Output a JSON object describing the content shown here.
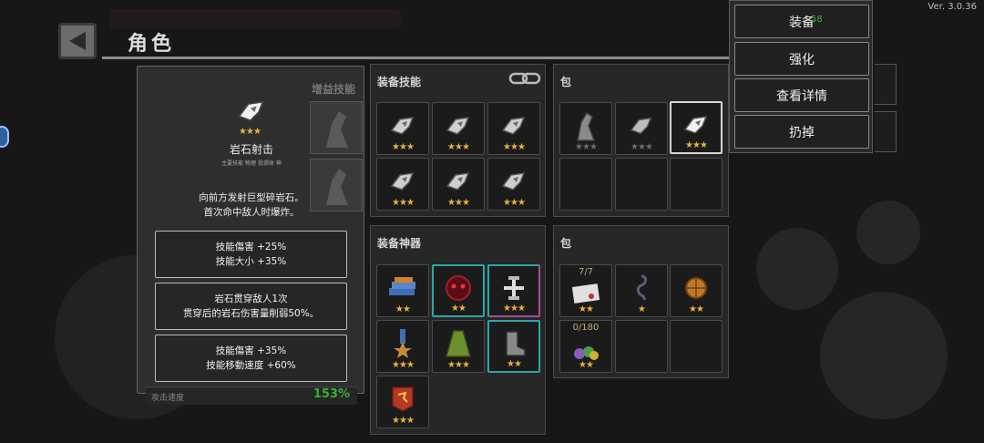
{
  "version": "Ver. 3.0.36",
  "header": {
    "title": "角色"
  },
  "detail": {
    "skill_name": "岩石射击",
    "skill_tags": "主要技能  物理  投掷体  神",
    "stars": "★★★",
    "description": "向前方发射巨型碎岩石。\n首次命中敌人时爆炸。",
    "upgrades": [
      "技能傷害 +25%\n技能大小 +35%",
      "岩石贯穿敌人1次\n贯穿后的岩石伤害量削弱50%。",
      "技能傷害 +35%\n技能移動速度 +60%"
    ],
    "side_label": "增益技能"
  },
  "stat_row": {
    "label": "攻击速度",
    "value": "153%"
  },
  "panels": {
    "equip_skills": {
      "title": "装备技能",
      "slots": [
        {
          "icon": "rock-skill-icon",
          "stars": "★★★"
        },
        {
          "icon": "rock-skill-icon",
          "stars": "★★★"
        },
        {
          "icon": "rock-skill-icon",
          "stars": "★★★"
        },
        {
          "icon": "rock-skill-icon",
          "stars": "★★★"
        },
        {
          "icon": "rock-skill-icon",
          "stars": "★★★"
        },
        {
          "icon": "rock-skill-icon",
          "stars": "★★★"
        }
      ]
    },
    "skill_bag": {
      "title": "包",
      "slots": [
        {
          "icon": "statue-icon",
          "stars": "★★★"
        },
        {
          "icon": "rock-skill-icon",
          "stars": "★★★"
        },
        {
          "icon": "rock-skill-icon",
          "stars": "★★★"
        }
      ]
    },
    "equip_artifacts": {
      "title": "装备神器",
      "slots": [
        {
          "icon": "books-icon",
          "stars": "★★"
        },
        {
          "icon": "demon-icon",
          "stars": "★★"
        },
        {
          "icon": "dumbbell-icon",
          "stars": "★★★"
        },
        {
          "icon": "medal-icon",
          "stars": "★★★"
        },
        {
          "icon": "cloak-icon",
          "stars": "★★★"
        },
        {
          "icon": "boots-icon",
          "stars": "★★"
        },
        {
          "icon": "dragon-banner-icon",
          "stars": "★★★"
        }
      ]
    },
    "artifact_bag": {
      "title": "包",
      "slots": [
        {
          "icon": "letter-icon",
          "stars": "★★",
          "count": "7/7"
        },
        {
          "icon": "hook-icon",
          "stars": "★"
        },
        {
          "icon": "shield-icon",
          "stars": "★★"
        },
        {
          "icon": "potions-icon",
          "stars": "★★",
          "count": "0/180"
        }
      ]
    }
  },
  "menu": {
    "items": [
      "装备",
      "强化",
      "查看详情",
      "扔掉"
    ],
    "badge": "58"
  },
  "colors": {
    "gold_star": "#e8b33a",
    "green_stat": "#35b235",
    "rare_teal": "#2aa7a7",
    "rare_pink": "#b0479a"
  }
}
